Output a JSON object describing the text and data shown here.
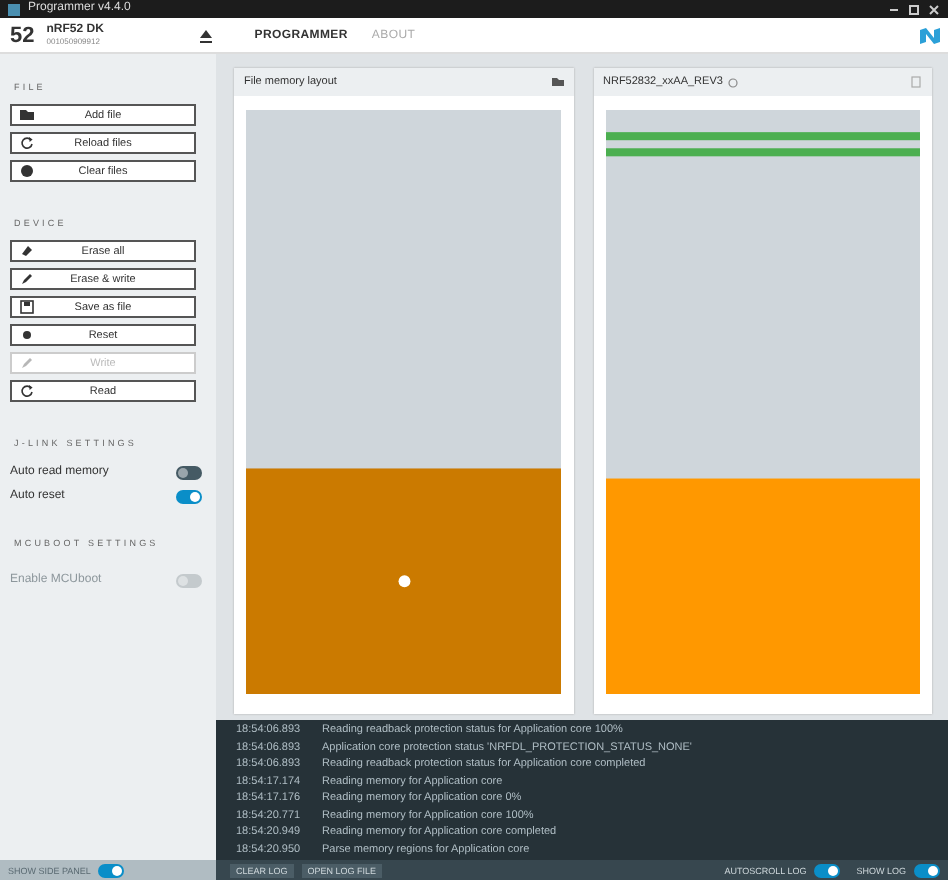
{
  "window": {
    "title": "Programmer v4.4.0"
  },
  "header": {
    "device_number": "52",
    "device_name": "nRF52 DK",
    "serial": "001050909912",
    "tabs": [
      {
        "label": "PROGRAMMER",
        "selected": true
      },
      {
        "label": "ABOUT",
        "selected": false
      }
    ]
  },
  "sidebar": {
    "sections": [
      {
        "title": "FILE",
        "items": [
          {
            "kind": "button",
            "label": "Add file",
            "disabled": false
          },
          {
            "kind": "button",
            "label": "Reload files",
            "disabled": false
          },
          {
            "kind": "button",
            "label": "Clear files",
            "disabled": false
          }
        ]
      },
      {
        "title": "DEVICE",
        "items": [
          {
            "kind": "button",
            "label": "Erase all",
            "disabled": false
          },
          {
            "kind": "button",
            "label": "Erase & write",
            "disabled": false
          },
          {
            "kind": "button",
            "label": "Save as file",
            "disabled": false
          },
          {
            "kind": "button",
            "label": "Reset",
            "disabled": false
          },
          {
            "kind": "button",
            "label": "Write",
            "disabled": true
          },
          {
            "kind": "button",
            "label": "Read",
            "disabled": false
          }
        ]
      },
      {
        "title": "J-LINK SETTINGS",
        "items": [
          {
            "kind": "toggle",
            "label": "Auto read memory",
            "on": false,
            "disabled": false
          },
          {
            "kind": "toggle",
            "label": "Auto reset",
            "on": true,
            "disabled": false
          }
        ]
      },
      {
        "title": "MCUBOOT SETTINGS",
        "items": [
          {
            "kind": "toggle",
            "label": "Enable MCUboot",
            "on": false,
            "disabled": true
          }
        ]
      }
    ]
  },
  "panels": [
    {
      "title": "File memory layout"
    },
    {
      "title": "NRF52832_xxAA_REV3"
    }
  ],
  "log": [
    {
      "time": "18:54:06.893",
      "message": "Reading readback protection status for Application core 100%"
    },
    {
      "time": "18:54:06.893",
      "message": "Application core protection status 'NRFDL_PROTECTION_STATUS_NONE'"
    },
    {
      "time": "18:54:06.893",
      "message": "Reading readback protection status for Application core completed"
    },
    {
      "time": "18:54:17.174",
      "message": "Reading memory for Application core"
    },
    {
      "time": "18:54:17.176",
      "message": "Reading memory for Application core 0%"
    },
    {
      "time": "18:54:20.771",
      "message": "Reading memory for Application core 100%"
    },
    {
      "time": "18:54:20.949",
      "message": "Reading memory for Application core completed"
    },
    {
      "time": "18:54:20.950",
      "message": "Parse memory regions for Application core"
    }
  ],
  "footer": {
    "show_side_panel": {
      "label": "SHOW SIDE PANEL",
      "on": true
    },
    "buttons": [
      "CLEAR LOG",
      "OPEN LOG FILE"
    ],
    "autoscroll_log": {
      "label": "AUTOSCROLL LOG",
      "on": true
    },
    "show_log": {
      "label": "SHOW LOG",
      "on": true
    }
  }
}
